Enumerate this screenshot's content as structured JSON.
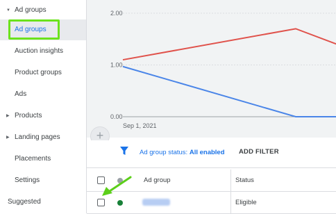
{
  "sidebar": {
    "group_header": "Ad groups",
    "items": [
      {
        "label": "Ad groups",
        "selected": true
      },
      {
        "label": "Auction insights"
      },
      {
        "label": "Product groups"
      },
      {
        "label": "Ads"
      },
      {
        "label": "Products",
        "expandable": true
      },
      {
        "label": "Landing pages",
        "expandable": true
      },
      {
        "label": "Placements"
      },
      {
        "label": "Settings"
      }
    ],
    "suggested": "Suggested"
  },
  "chart_data": {
    "type": "line",
    "x": [
      "Sep 1, 2021",
      "",
      ""
    ],
    "ylim": [
      0,
      2
    ],
    "yticks": [
      "0.00",
      "1.00",
      "2.00"
    ],
    "series": [
      {
        "color": "#e0524b",
        "values": [
          1.1,
          1.7,
          1.3
        ]
      },
      {
        "color": "#4a85e8",
        "values": [
          0.97,
          0.0,
          0.0
        ]
      }
    ],
    "grid": true
  },
  "add_button": {
    "icon": "plus-icon",
    "symbol": "+"
  },
  "filter": {
    "prefix": "Ad group status:",
    "value": "All enabled",
    "add_filter": "ADD FILTER"
  },
  "table": {
    "columns": [
      "Ad group",
      "Status"
    ],
    "rows": [
      {
        "status": "Eligible",
        "dot_color": "#188038"
      }
    ]
  },
  "colors": {
    "highlight": "#6be31c",
    "accent": "#1a73e8"
  }
}
